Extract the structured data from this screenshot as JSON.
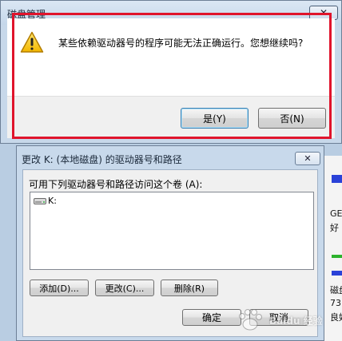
{
  "message_dialog": {
    "title": "磁盘管理",
    "close_label": "✕",
    "message": "某些依赖驱动器号的程序可能无法正确运行。您想继续吗?",
    "yes_label": "是(Y)",
    "no_label": "否(N)"
  },
  "change_dialog": {
    "title": "更改 K: (本地磁盘) 的驱动器号和路径",
    "close_label": "✕",
    "list_label": "可用下列驱动器号和路径访问这个卷 (A):",
    "paths": [
      "K:"
    ],
    "add_label": "添加(D)...",
    "change_label": "更改(C)...",
    "remove_label": "删除(R)",
    "ok_label": "确定",
    "cancel_label": "取消"
  },
  "background_app": {
    "fragments": [
      "GE",
      "好 (",
      "磁盘",
      "73",
      "良好"
    ]
  },
  "watermark": {
    "text": "Baidu 经验"
  },
  "colors": {
    "highlight": "#e0142c",
    "title_bar": "#c7d8ea",
    "disk_blue": "#2a42d8",
    "disk_green": "#2db32d"
  },
  "icons": [
    "warning-icon",
    "close-icon",
    "drive-icon",
    "baidu-paw-icon"
  ]
}
